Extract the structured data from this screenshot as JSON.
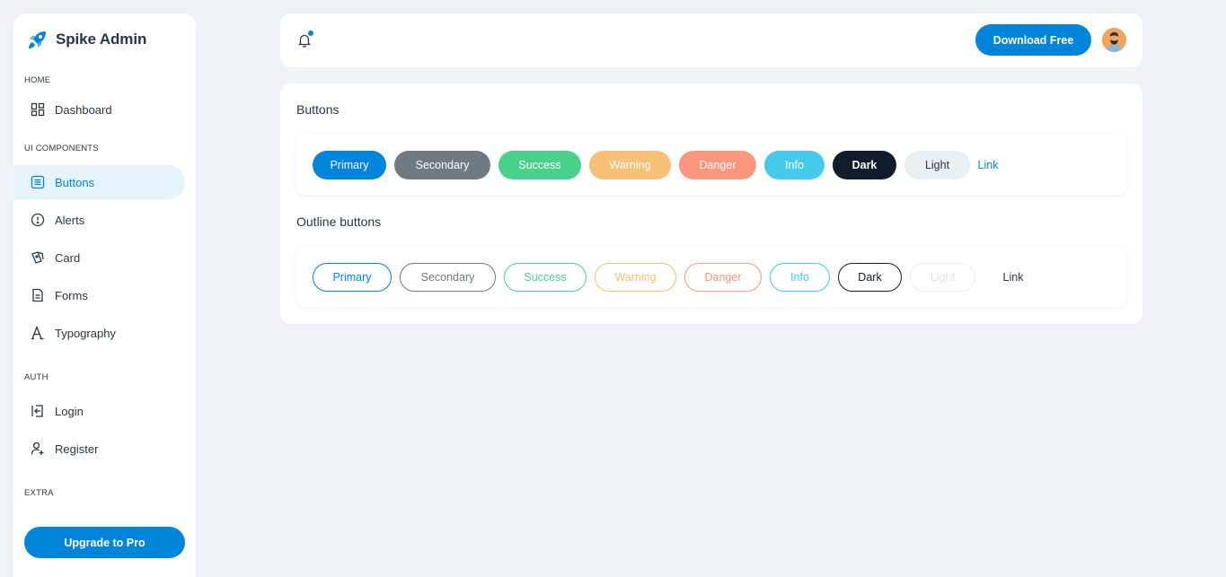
{
  "brand": {
    "name": "Spike Admin"
  },
  "sidebar": {
    "caption_home": "HOME",
    "caption_ui": "UI COMPONENTS",
    "caption_auth": "AUTH",
    "caption_extra": "EXTRA",
    "items": [
      {
        "label": "Dashboard",
        "icon": "dashboard-icon"
      },
      {
        "label": "Buttons",
        "icon": "list-icon",
        "active": true
      },
      {
        "label": "Alerts",
        "icon": "alert-circle-icon"
      },
      {
        "label": "Card",
        "icon": "cards-icon"
      },
      {
        "label": "Forms",
        "icon": "file-icon"
      },
      {
        "label": "Typography",
        "icon": "typography-icon"
      },
      {
        "label": "Login",
        "icon": "login-icon"
      },
      {
        "label": "Register",
        "icon": "user-plus-icon"
      }
    ],
    "upgrade_label": "Upgrade to Pro"
  },
  "header": {
    "download_label": "Download Free"
  },
  "main": {
    "solid_title": "Buttons",
    "outline_title": "Outline buttons",
    "solid_buttons": [
      "Primary",
      "Secondary",
      "Success",
      "Warning",
      "Danger",
      "Info",
      "Dark",
      "Light",
      "Link"
    ],
    "outline_buttons": [
      "Primary",
      "Secondary",
      "Success",
      "Warning",
      "Danger",
      "Info",
      "Dark",
      "Light",
      "Link"
    ]
  },
  "colors": {
    "primary": "#0085db",
    "secondary": "#707a82",
    "success": "#4bd08b",
    "warning": "#f8c076",
    "danger": "#fb977d",
    "info": "#46caeb",
    "dark": "#111c2d",
    "light": "#eaeff4"
  }
}
